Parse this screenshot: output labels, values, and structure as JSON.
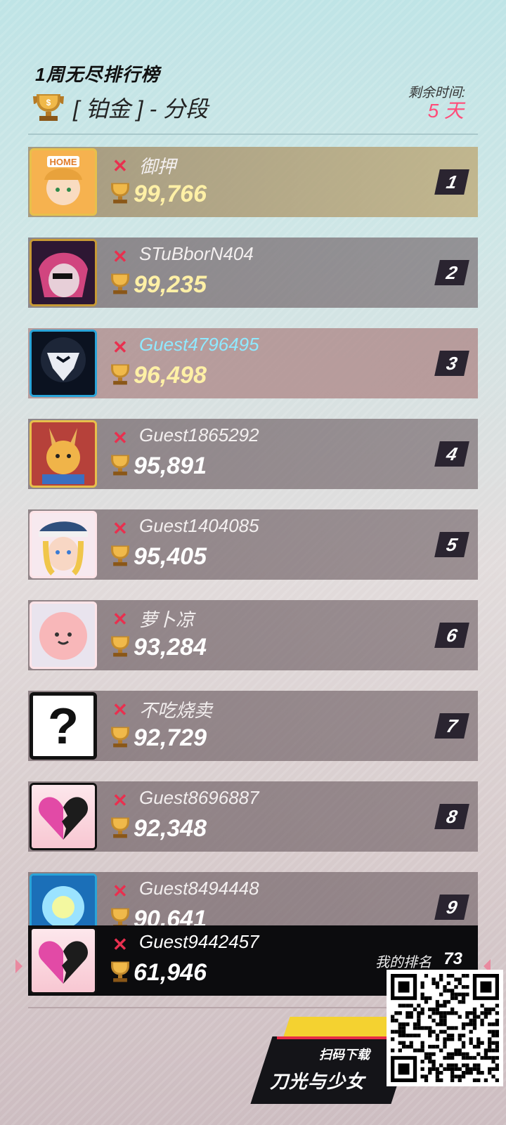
{
  "header": {
    "title": "1周无尽排行榜",
    "tier_label": "[ 铂金 ] - 分段",
    "remaining_label": "剩余时间:",
    "remaining_value": "5 天"
  },
  "leaderboard": [
    {
      "rank": "1",
      "name": "御押",
      "score": "99,766",
      "avatar": "home-girl-avatar"
    },
    {
      "rank": "2",
      "name": "STuBborN404",
      "score": "99,235",
      "avatar": "eyepatch-girl-avatar"
    },
    {
      "rank": "3",
      "name": "Guest4796495",
      "score": "96,498",
      "avatar": "mask-emblem-avatar"
    },
    {
      "rank": "4",
      "name": "Guest1865292",
      "score": "95,891",
      "avatar": "bunny-mascot-avatar"
    },
    {
      "rank": "5",
      "name": "Guest1404085",
      "score": "95,405",
      "avatar": "captain-girl-avatar"
    },
    {
      "rank": "6",
      "name": "萝卜凉",
      "score": "93,284",
      "avatar": "pink-blob-avatar"
    },
    {
      "rank": "7",
      "name": "不吃烧卖",
      "score": "92,729",
      "avatar": "question-mark-avatar"
    },
    {
      "rank": "8",
      "name": "Guest8696887",
      "score": "92,348",
      "avatar": "broken-heart-avatar"
    },
    {
      "rank": "9",
      "name": "Guest8494448",
      "score": "90,641",
      "avatar": "blue-orb-avatar"
    }
  ],
  "my_entry": {
    "name": "Guest9442457",
    "score": "61,946",
    "rank_label": "我的排名",
    "rank_value": "73"
  },
  "promo": {
    "scan_text": "扫码下载",
    "game_name": "刀光与少女"
  },
  "colors": {
    "accent_pink": "#ff4d7a",
    "x_red": "#e8304f",
    "score_gold": "#fff0a6"
  }
}
